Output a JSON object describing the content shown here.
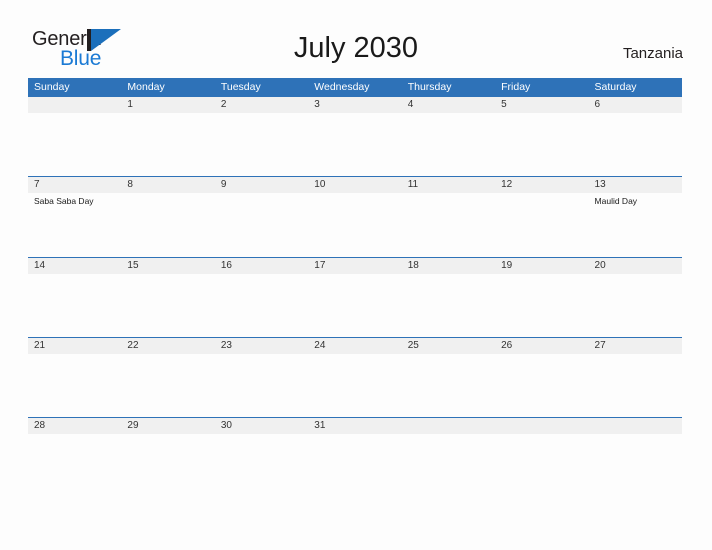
{
  "brand": {
    "name_part1": "General",
    "name_part2": "Blue",
    "mark": "sail-triangle",
    "color_blue": "#1b7ad4",
    "color_dark": "#231f20"
  },
  "header": {
    "title": "July 2030",
    "country": "Tanzania"
  },
  "calendar": {
    "accent_color": "#2e72b8",
    "band_color": "#f0f0f0",
    "weekday_headers": [
      "Sunday",
      "Monday",
      "Tuesday",
      "Wednesday",
      "Thursday",
      "Friday",
      "Saturday"
    ],
    "weeks": [
      {
        "days": [
          {
            "num": "",
            "event": ""
          },
          {
            "num": "1",
            "event": ""
          },
          {
            "num": "2",
            "event": ""
          },
          {
            "num": "3",
            "event": ""
          },
          {
            "num": "4",
            "event": ""
          },
          {
            "num": "5",
            "event": ""
          },
          {
            "num": "6",
            "event": ""
          }
        ]
      },
      {
        "days": [
          {
            "num": "7",
            "event": "Saba Saba Day"
          },
          {
            "num": "8",
            "event": ""
          },
          {
            "num": "9",
            "event": ""
          },
          {
            "num": "10",
            "event": ""
          },
          {
            "num": "11",
            "event": ""
          },
          {
            "num": "12",
            "event": ""
          },
          {
            "num": "13",
            "event": "Maulid Day"
          }
        ]
      },
      {
        "days": [
          {
            "num": "14",
            "event": ""
          },
          {
            "num": "15",
            "event": ""
          },
          {
            "num": "16",
            "event": ""
          },
          {
            "num": "17",
            "event": ""
          },
          {
            "num": "18",
            "event": ""
          },
          {
            "num": "19",
            "event": ""
          },
          {
            "num": "20",
            "event": ""
          }
        ]
      },
      {
        "days": [
          {
            "num": "21",
            "event": ""
          },
          {
            "num": "22",
            "event": ""
          },
          {
            "num": "23",
            "event": ""
          },
          {
            "num": "24",
            "event": ""
          },
          {
            "num": "25",
            "event": ""
          },
          {
            "num": "26",
            "event": ""
          },
          {
            "num": "27",
            "event": ""
          }
        ]
      },
      {
        "days": [
          {
            "num": "28",
            "event": ""
          },
          {
            "num": "29",
            "event": ""
          },
          {
            "num": "30",
            "event": ""
          },
          {
            "num": "31",
            "event": ""
          },
          {
            "num": "",
            "event": ""
          },
          {
            "num": "",
            "event": ""
          },
          {
            "num": "",
            "event": ""
          }
        ]
      }
    ]
  }
}
